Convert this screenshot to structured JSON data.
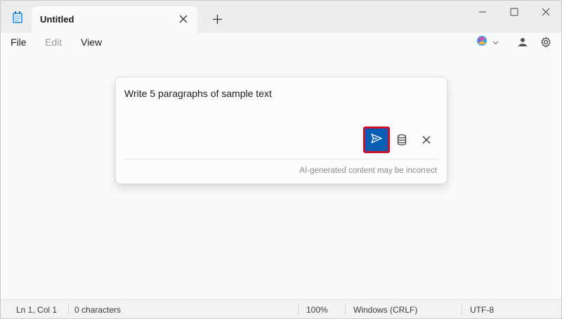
{
  "titlebar": {
    "tab_title": "Untitled",
    "icons": [
      "notepad-icon",
      "close-icon",
      "plus-icon",
      "minimize-icon",
      "maximize-icon",
      "close-icon"
    ]
  },
  "menu": {
    "file": "File",
    "edit": "Edit",
    "view": "View"
  },
  "popup": {
    "prompt": "Write 5 paragraphs of sample text",
    "disclaimer": "AI-generated content may be incorrect",
    "accent_color": "#0a5fb4",
    "highlight_color": "#c8102e"
  },
  "status": {
    "position": "Ln 1, Col 1",
    "characters": "0 characters",
    "zoom": "100%",
    "line_ending": "Windows (CRLF)",
    "encoding": "UTF-8"
  }
}
